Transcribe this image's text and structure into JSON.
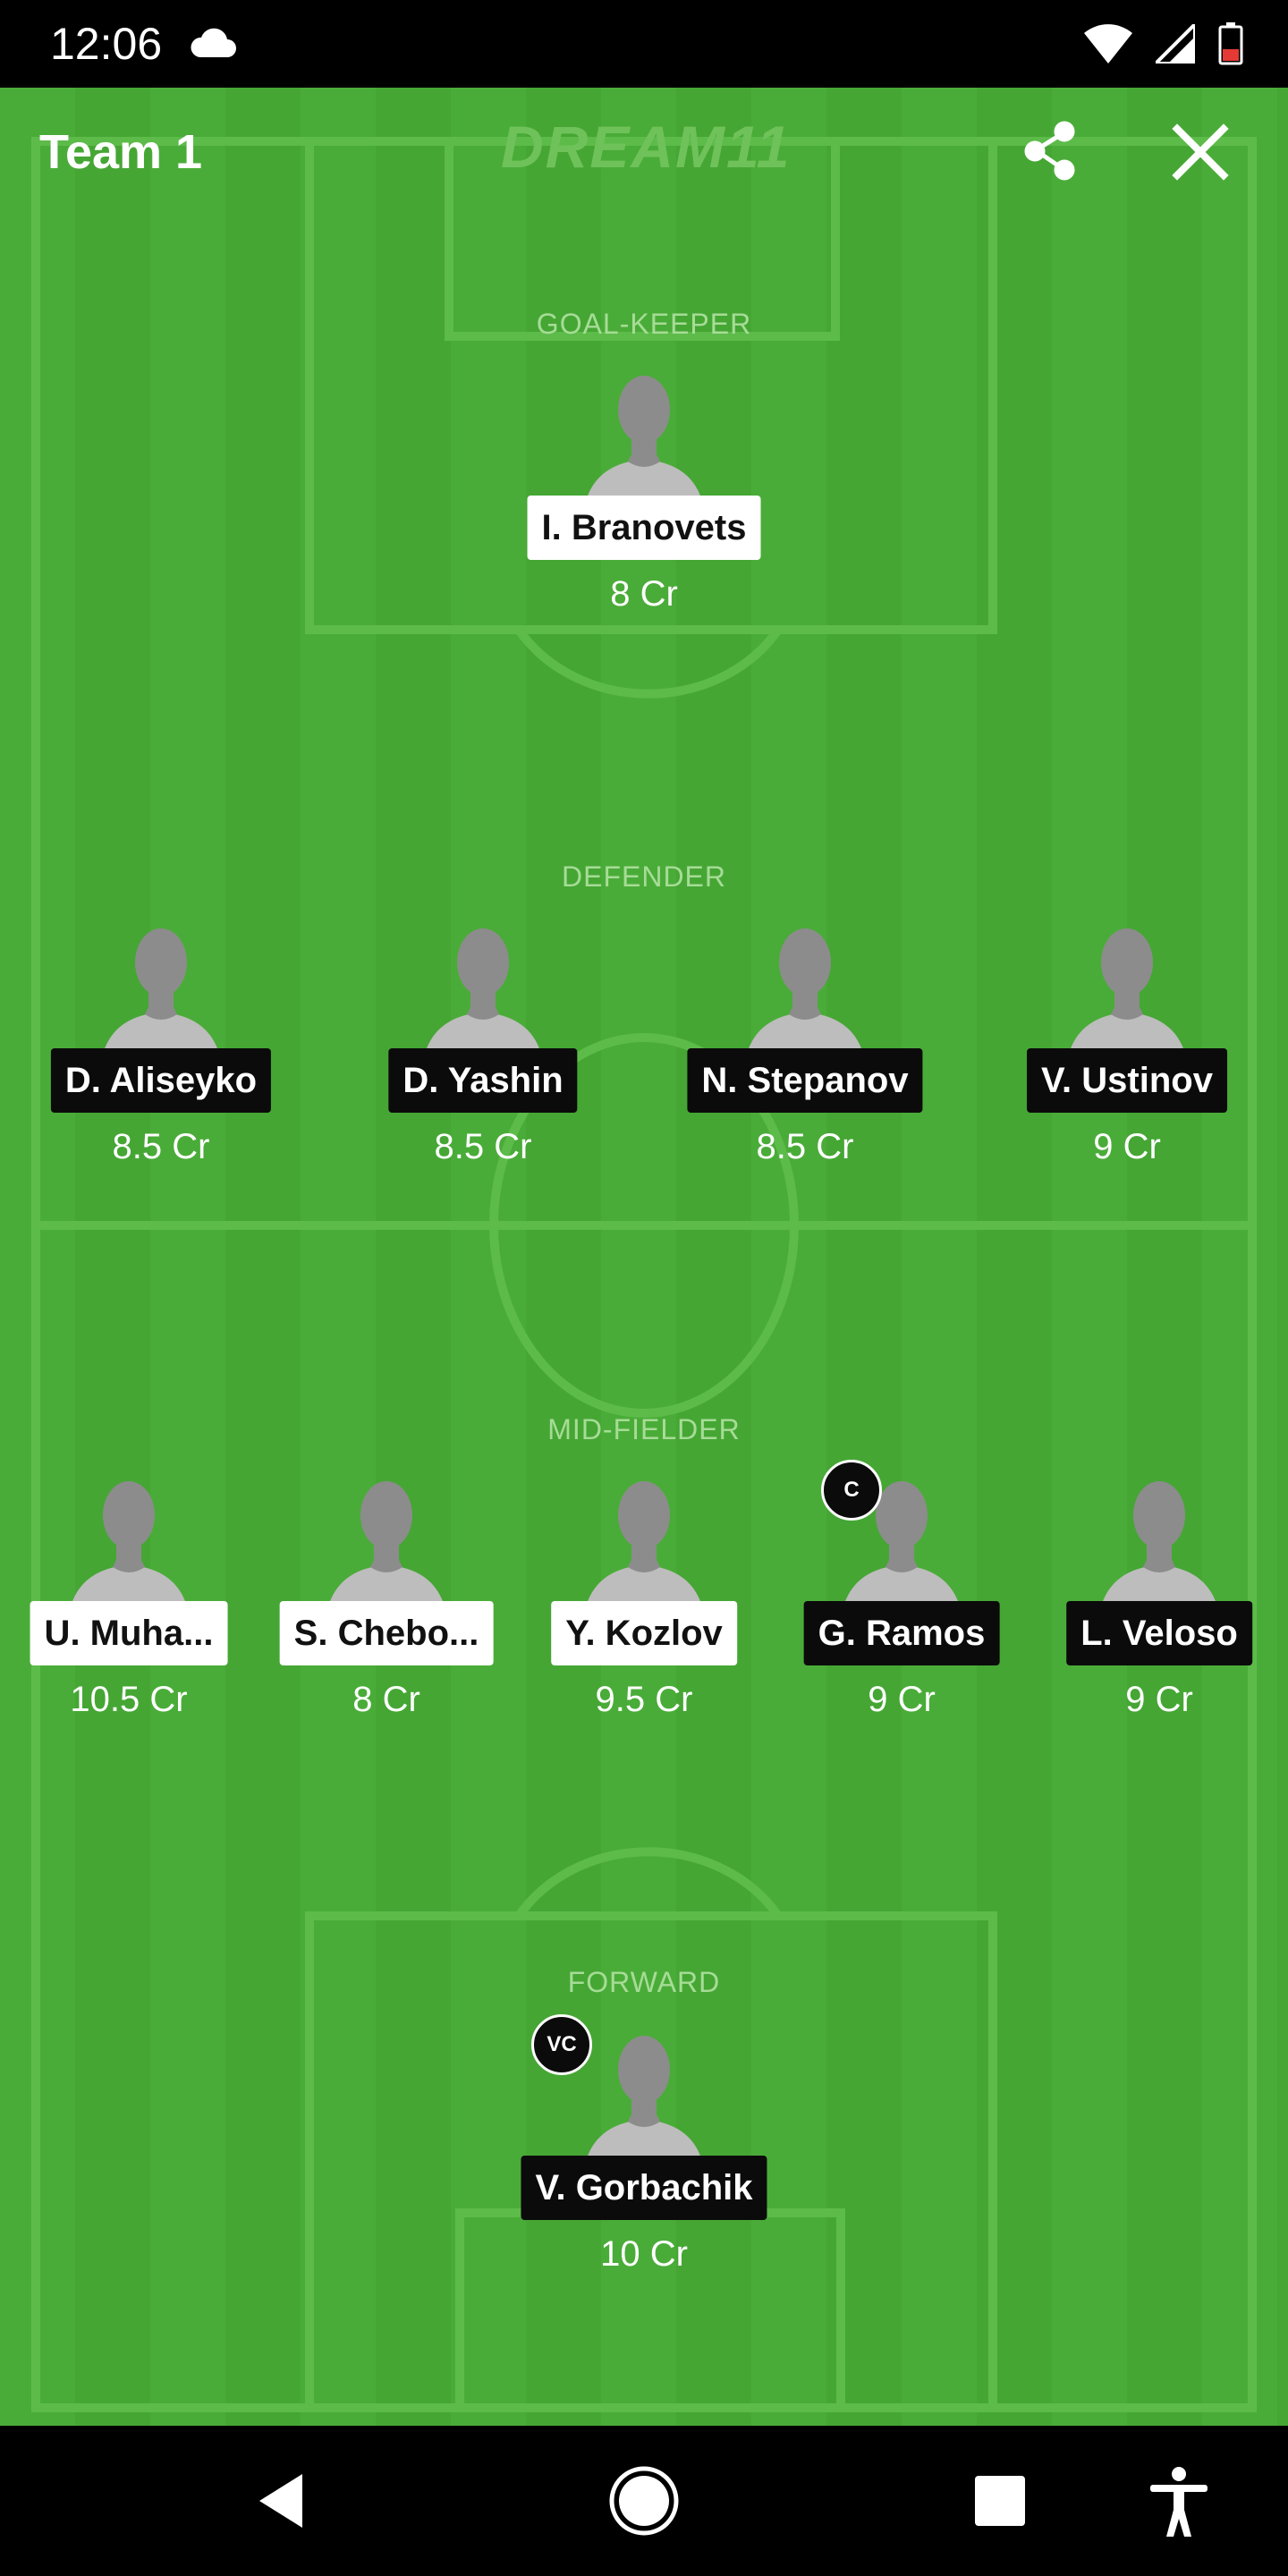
{
  "status_bar": {
    "time": "12:06",
    "icons": [
      "cloud-icon",
      "wifi-icon",
      "signal-icon",
      "battery-icon"
    ]
  },
  "header": {
    "team_name": "Team 1",
    "brand": "DREAM11",
    "share_icon": "share-icon",
    "close_icon": "close-icon"
  },
  "roles": {
    "goalkeeper": "GOAL-KEEPER",
    "defender": "DEFENDER",
    "midfielder": "MID-FIELDER",
    "forward": "FORWARD"
  },
  "players": {
    "goalkeeper": [
      {
        "name": "I. Branovets",
        "credits": "8 Cr",
        "tag": "white"
      }
    ],
    "defenders": [
      {
        "name": "D. Aliseyko",
        "credits": "8.5 Cr",
        "tag": "black"
      },
      {
        "name": "D. Yashin",
        "credits": "8.5 Cr",
        "tag": "black"
      },
      {
        "name": "N. Stepanov",
        "credits": "8.5 Cr",
        "tag": "black"
      },
      {
        "name": "V. Ustinov",
        "credits": "9 Cr",
        "tag": "black"
      }
    ],
    "midfielders": [
      {
        "name": "U. Muha...",
        "credits": "10.5 Cr",
        "tag": "white"
      },
      {
        "name": "S. Chebo...",
        "credits": "8 Cr",
        "tag": "white"
      },
      {
        "name": "Y. Kozlov",
        "credits": "9.5 Cr",
        "tag": "white"
      },
      {
        "name": "G. Ramos",
        "credits": "9 Cr",
        "tag": "black",
        "badge": "C"
      },
      {
        "name": "L. Veloso",
        "credits": "9 Cr",
        "tag": "black"
      }
    ],
    "forwards": [
      {
        "name": "V. Gorbachik",
        "credits": "10 Cr",
        "tag": "black",
        "badge": "VC"
      }
    ]
  },
  "nav_bar": {
    "icons": [
      "back-icon",
      "home-icon",
      "recents-icon",
      "accessibility-icon"
    ]
  },
  "colors": {
    "pitch_light": "#4aac38",
    "pitch_dark": "#45a634",
    "pitch_lines": "#5dbb4a",
    "label": "#a6dc96"
  }
}
